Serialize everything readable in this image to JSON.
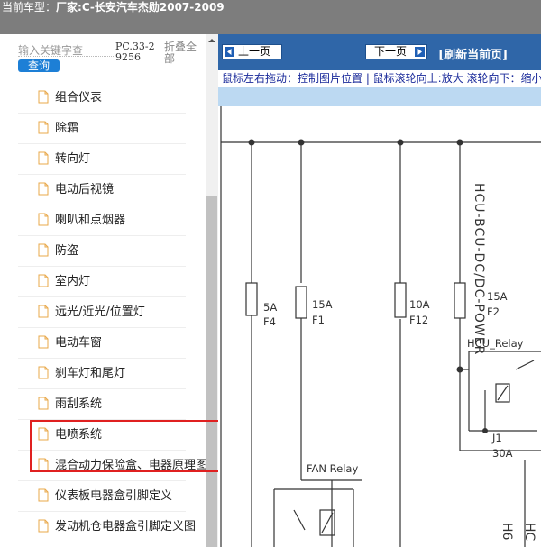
{
  "header": {
    "car_prefix": "当前车型：",
    "car_name": "厂家:C-长安汽车杰勋2007-2009"
  },
  "search": {
    "placeholder": "输入关键字查",
    "button_label": "查询",
    "pc_code": "PC.33-29256",
    "collapse_all": "折叠全部"
  },
  "tree": {
    "items": [
      {
        "label": "组合仪表"
      },
      {
        "label": "除霜"
      },
      {
        "label": "转向灯"
      },
      {
        "label": "电动后视镜"
      },
      {
        "label": "喇叭和点烟器"
      },
      {
        "label": "防盗"
      },
      {
        "label": "室内灯"
      },
      {
        "label": "远光/近光/位置灯"
      },
      {
        "label": "电动车窗"
      },
      {
        "label": "刹车灯和尾灯"
      },
      {
        "label": "雨刮系统"
      },
      {
        "label": "电喷系统"
      },
      {
        "label": "混合动力保险盒、电器原理图"
      },
      {
        "label": "仪表板电器盒引脚定义"
      },
      {
        "label": "发动机仓电器盒引脚定义图"
      }
    ]
  },
  "viewer": {
    "prev_label": "上一页",
    "next_label": "下一页",
    "refresh_label": "[刷新当前页]",
    "hint": "鼠标左右拖动：控制图片位置 | 鼠标滚轮向上:放大   滚轮向下：缩小"
  },
  "diagram": {
    "bus_label": "HCU-BCU-DC/DC-POWER",
    "fuses": [
      {
        "rating": "5A",
        "name": "F4"
      },
      {
        "rating": "15A",
        "name": "F1"
      },
      {
        "rating": "10A",
        "name": "F12"
      },
      {
        "rating": "15A",
        "name": "F2"
      }
    ],
    "hcu_relay": "HCU_Relay",
    "j1_name": "J1",
    "j1_rating": "30A",
    "fan_relay": "FAN Relay",
    "h6_label": "H6",
    "hc_label": "HC"
  },
  "colors": {
    "topbar": "#7d7d7d",
    "toolbar": "#2f66a8",
    "strip": "#bcd9f2",
    "highlight": "#e02020",
    "search_button": "#1d7fd6"
  }
}
